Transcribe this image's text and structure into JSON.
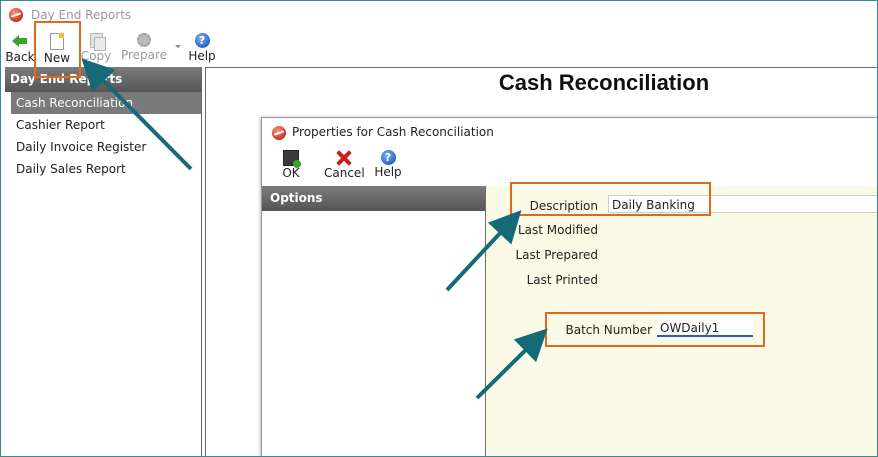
{
  "window": {
    "title": "Day End Reports"
  },
  "toolbar": {
    "back_label": "Back",
    "new_label": "New",
    "copy_label": "Copy",
    "prepare_label": "Prepare",
    "help_label": "Help"
  },
  "sidebar": {
    "header": "Day End Reports",
    "items": [
      {
        "label": "Cash Reconciliation",
        "selected": true
      },
      {
        "label": "Cashier Report"
      },
      {
        "label": "Daily Invoice Register"
      },
      {
        "label": "Daily Sales Report"
      }
    ]
  },
  "main": {
    "title": "Cash Reconciliation"
  },
  "dialog": {
    "title": "Properties for Cash Reconciliation",
    "toolbar": {
      "ok_label": "OK",
      "cancel_label": "Cancel",
      "help_label": "Help"
    },
    "options_header": "Options",
    "fields": {
      "description_label": "Description",
      "description_value": "Daily Banking",
      "last_modified_label": "Last Modified",
      "last_prepared_label": "Last Prepared",
      "last_printed_label": "Last Printed",
      "batch_number_label": "Batch Number",
      "batch_number_value": "OWDaily1"
    }
  },
  "colors": {
    "callout": "#e06a1c",
    "arrow": "#166a78",
    "form_bg": "#fafae6",
    "header_bg": "#666666"
  },
  "icons": [
    "app-logo-icon",
    "back-arrow-icon",
    "new-document-icon",
    "copy-icon",
    "prepare-gear-icon",
    "help-icon",
    "ok-save-icon",
    "cancel-x-icon"
  ]
}
